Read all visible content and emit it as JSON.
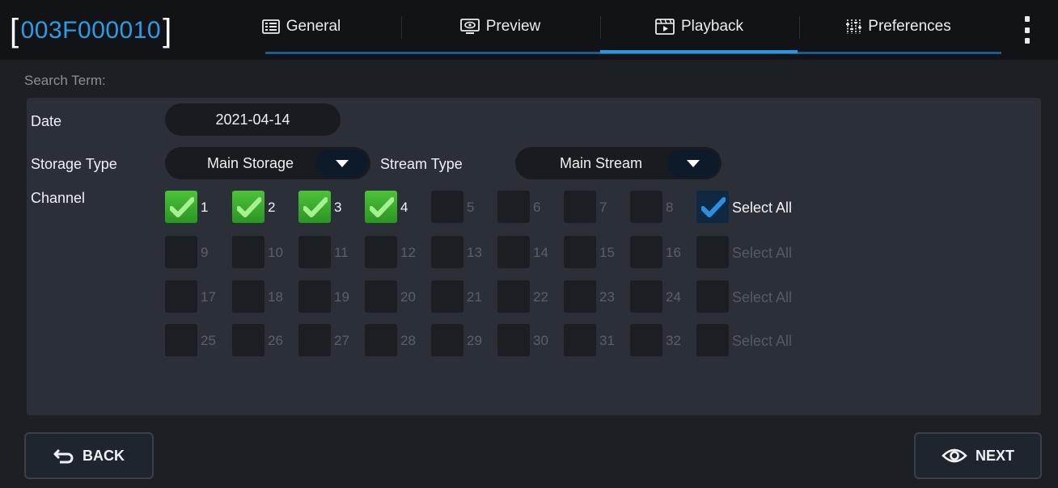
{
  "device": {
    "id": "003F000010",
    "bracket_open": "[",
    "bracket_close": "]"
  },
  "tabs": [
    {
      "label": "General",
      "icon": "grid-list-icon"
    },
    {
      "label": "Preview",
      "icon": "monitor-eye-icon"
    },
    {
      "label": "Playback",
      "icon": "film-play-icon",
      "active": true
    },
    {
      "label": "Preferences",
      "icon": "sliders-icon"
    }
  ],
  "search": {
    "heading": "Search Term:",
    "date_label": "Date",
    "date_value": "2021-04-14",
    "storage_label": "Storage Type",
    "storage_value": "Main Storage",
    "stream_label": "Stream Type",
    "stream_value": "Main Stream",
    "channel_label": "Channel"
  },
  "channels": {
    "rows": [
      {
        "numbers": [
          "1",
          "2",
          "3",
          "4",
          "5",
          "6",
          "7",
          "8"
        ],
        "checked": [
          true,
          true,
          true,
          true,
          false,
          false,
          false,
          false
        ],
        "enabled": [
          true,
          true,
          true,
          true,
          false,
          false,
          false,
          false
        ],
        "select_all": "Select All",
        "select_all_checked": true,
        "select_all_enabled": true
      },
      {
        "numbers": [
          "9",
          "10",
          "11",
          "12",
          "13",
          "14",
          "15",
          "16"
        ],
        "checked": [
          false,
          false,
          false,
          false,
          false,
          false,
          false,
          false
        ],
        "enabled": [
          false,
          false,
          false,
          false,
          false,
          false,
          false,
          false
        ],
        "select_all": "Select All",
        "select_all_checked": false,
        "select_all_enabled": false
      },
      {
        "numbers": [
          "17",
          "18",
          "19",
          "20",
          "21",
          "22",
          "23",
          "24"
        ],
        "checked": [
          false,
          false,
          false,
          false,
          false,
          false,
          false,
          false
        ],
        "enabled": [
          false,
          false,
          false,
          false,
          false,
          false,
          false,
          false
        ],
        "select_all": "Select All",
        "select_all_checked": false,
        "select_all_enabled": false
      },
      {
        "numbers": [
          "25",
          "26",
          "27",
          "28",
          "29",
          "30",
          "31",
          "32"
        ],
        "checked": [
          false,
          false,
          false,
          false,
          false,
          false,
          false,
          false
        ],
        "enabled": [
          false,
          false,
          false,
          false,
          false,
          false,
          false,
          false
        ],
        "select_all": "Select All",
        "select_all_checked": false,
        "select_all_enabled": false
      }
    ]
  },
  "footer": {
    "back_label": "BACK",
    "next_label": "NEXT"
  },
  "colors": {
    "accent": "#2e95dd",
    "check_green": "#3aae2c",
    "check_blue": "#2e8ee0"
  }
}
